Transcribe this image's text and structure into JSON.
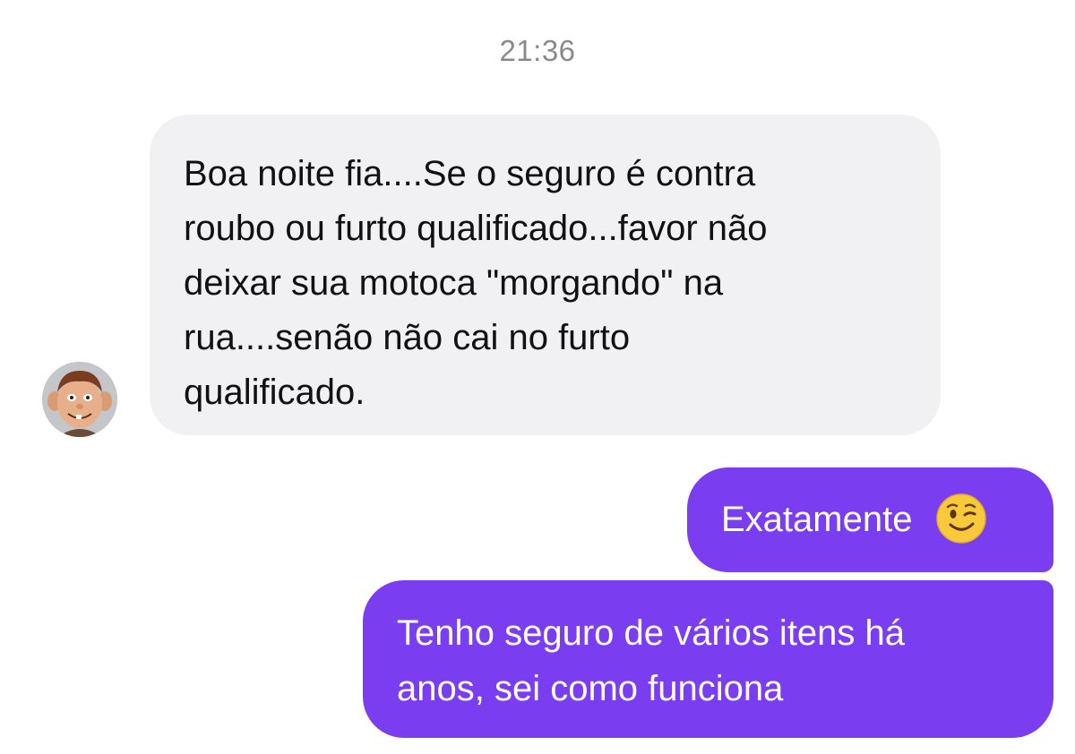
{
  "chat": {
    "timestamp": "21:36",
    "avatar_icon": "cartoon-face-avatar",
    "messages": [
      {
        "direction": "incoming",
        "text": "Boa noite fia....Se o seguro é contra\nroubo ou furto qualificado...favor não\ndeixar sua motoca \"morgando\" na\nrua....senão não cai no furto\nqualificado."
      },
      {
        "direction": "outgoing",
        "text": "Exatamente",
        "emoji": "winking-face-emoji"
      },
      {
        "direction": "outgoing",
        "text": "Tenho seguro de vários itens há\nanos, sei como funciona"
      }
    ]
  },
  "colors": {
    "incoming_bubble": "#f1f1f3",
    "outgoing_bubble": "#7a3ef0",
    "timestamp": "#8a8a8e"
  }
}
